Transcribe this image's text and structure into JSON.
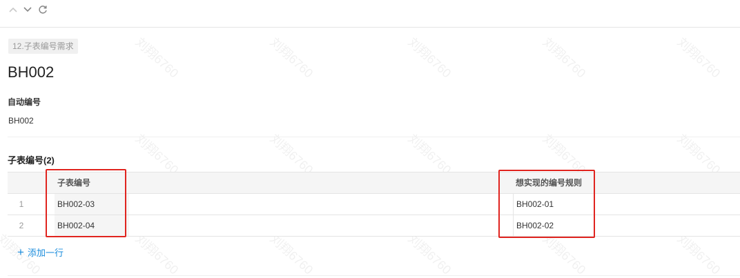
{
  "toolbar": {
    "prev_icon": "chevron-up-icon",
    "next_icon": "chevron-down-icon",
    "refresh_icon": "refresh-icon"
  },
  "tag": "12.子表编号需求",
  "record_title": "BH002",
  "fields": [
    {
      "label": "自动编号",
      "value": "BH002"
    }
  ],
  "subtable": {
    "title": "子表编号(2)",
    "columns": [
      "子表编号",
      "想实现的编号规则"
    ],
    "rows": [
      {
        "index": "1",
        "cells": [
          "BH002-03",
          "BH002-01"
        ]
      },
      {
        "index": "2",
        "cells": [
          "BH002-04",
          "BH002-02"
        ]
      }
    ],
    "add_row_label": "添加一行"
  },
  "colors": {
    "accent": "#1a8cdc",
    "highlight_box": "#e0231e"
  }
}
